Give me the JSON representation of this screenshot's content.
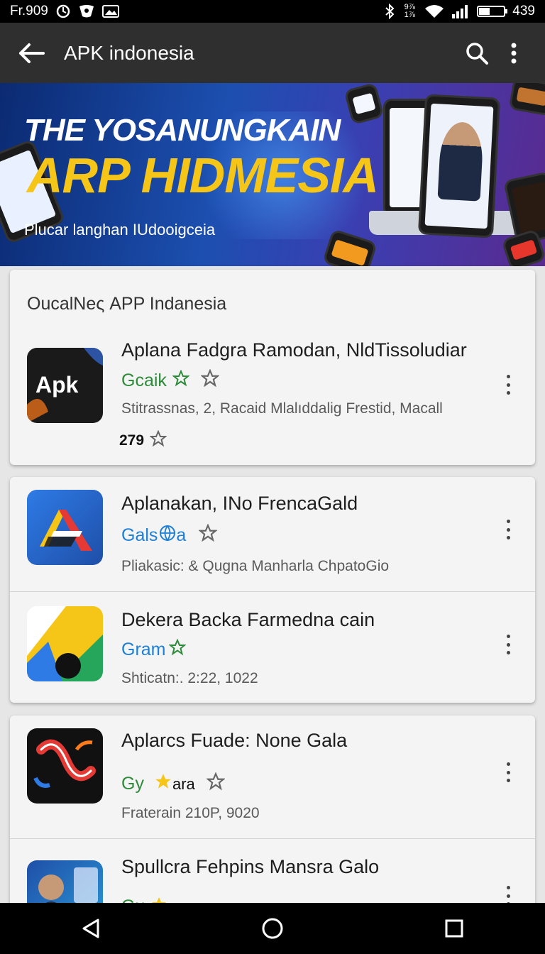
{
  "status_bar": {
    "time": "Fr.909",
    "network_label": "9⅞ 1⅞",
    "battery_text": "439",
    "battery_level": 0.45,
    "icons": [
      "sync-icon",
      "shield-icon",
      "image-icon",
      "bluetooth-icon",
      "wifi-icon",
      "signal-icon",
      "battery-icon"
    ]
  },
  "app_bar": {
    "title": "APK indonesia",
    "icons": [
      "back-arrow-icon",
      "search-icon",
      "more-vert-icon"
    ]
  },
  "banner": {
    "line1": "THE YOSANUNGKAIN",
    "line2": "ARP HIDMESIA",
    "line3": "Plucar langhan IUdooigceia"
  },
  "section": {
    "title": "OucalNeς APP Indanesia"
  },
  "apps": [
    {
      "name": "Aplana Fadgra Ramodan, NldTissoludiar",
      "developer": "Gcaik",
      "developer_color": "#2e8b3a",
      "meta": "Stitrassnas, 2, Racaid Mlalıddalig Frestid, Macall",
      "rating": "279",
      "icon": "apk-logo-icon",
      "icon_text": "Apk"
    },
    {
      "name": "Aplanakan, INo FrencaGald",
      "developer": "Gals",
      "developer_suffix": "a",
      "developer_color": "#1e7fd6",
      "meta": "Pliakasic:  & Qugna Manharla ChpatoGio",
      "icon": "letter-a-logo-icon"
    },
    {
      "name": "Dekera Backa Farmedna cain",
      "developer": "Gram",
      "developer_color": "#1e7fd6",
      "meta": "Shticatn:.  2:22, 1022",
      "icon": "drive-logo-icon"
    },
    {
      "name": "Aplarcs Fuade: None Gala",
      "developer": "Gy",
      "developer_suffix": "ara",
      "developer_color": "#2e8b3a",
      "meta": "Fraterain 210P, 9020",
      "icon": "swirl-logo-icon"
    },
    {
      "name": "Spullcra Fehpins Mansra Galo",
      "developer": "Gu",
      "developer_color": "#2e8b3a",
      "icon": "person-thumbnail-icon"
    }
  ],
  "nav_bar": {
    "icons": [
      "back-triangle-icon",
      "home-circle-icon",
      "recents-square-icon"
    ]
  }
}
